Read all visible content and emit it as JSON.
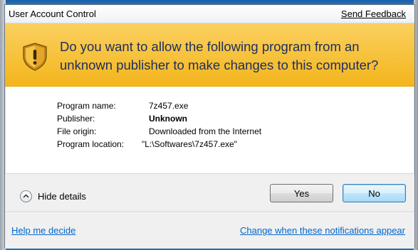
{
  "window": {
    "title": "User Account Control",
    "send_feedback": "Send Feedback"
  },
  "banner": {
    "question": "Do you want to allow the following program from an unknown publisher to make changes to this computer?"
  },
  "details": {
    "program_name": {
      "label": "Program name:",
      "value": "7z457.exe"
    },
    "publisher": {
      "label": "Publisher:",
      "value": "Unknown"
    },
    "file_origin": {
      "label": "File origin:",
      "value": "Downloaded from the Internet"
    },
    "program_location": {
      "label": "Program location:",
      "value": "\"L:\\Softwares\\7z457.exe\""
    }
  },
  "footer": {
    "hide_details": "Hide details",
    "yes": "Yes",
    "no": "No",
    "help_link": "Help me decide",
    "change_link": "Change when these notifications appear"
  },
  "colors": {
    "banner": "#f3b51c",
    "question_text": "#1c2e5e",
    "link": "#0066cc",
    "default_button_border": "#3c7fb1"
  },
  "icons": {
    "banner": "shield-warning-icon",
    "details_toggle": "chevron-up-icon"
  }
}
